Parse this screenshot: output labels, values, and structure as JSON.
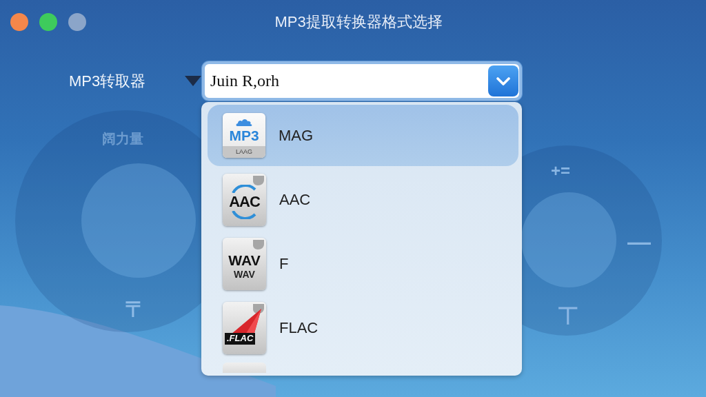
{
  "window": {
    "title": "MP3提取转换器格式选择",
    "controls": [
      {
        "color": "#f4874b"
      },
      {
        "color": "#3ecb5c"
      },
      {
        "color": "#8ba5c9"
      }
    ]
  },
  "dials": [
    {
      "top": "阔力量",
      "bottom": "〒"
    },
    {
      "top": "+=",
      "right": "—",
      "bottom": "丅"
    }
  ],
  "format_picker": {
    "label": "MP3转取器",
    "value": "Juin R,orh",
    "expanded": true
  },
  "formats": [
    {
      "kind": "mp3",
      "label": "MAG",
      "badge": "MP3",
      "caption": "LAAG",
      "selected": true
    },
    {
      "kind": "aac",
      "label": "AAC",
      "badge": "AAC",
      "selected": false
    },
    {
      "kind": "wav",
      "label": "F",
      "badge": "WAV",
      "caption": "WAV",
      "selected": false
    },
    {
      "kind": "flac",
      "label": "FLAC",
      "badge": ".FLAC",
      "selected": false
    },
    {
      "kind": "generic",
      "selected": false
    }
  ]
}
